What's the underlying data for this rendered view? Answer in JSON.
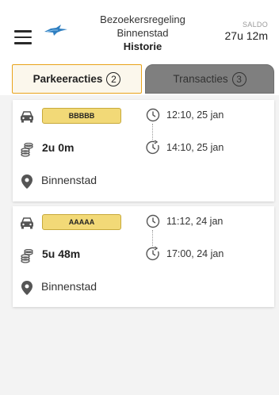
{
  "header": {
    "title_line1": "Bezoekersregeling",
    "title_line2": "Binnenstad",
    "subtitle": "Historie",
    "saldo_label": "SALDO",
    "saldo_value": "27u 12m"
  },
  "tabs": [
    {
      "label": "Parkeeracties",
      "count": "2",
      "active": true
    },
    {
      "label": "Transacties",
      "count": "3",
      "active": false
    }
  ],
  "parkings": [
    {
      "plate": "BBBBB",
      "duration": "2u 0m",
      "location": "Binnenstad",
      "start": "12:10, 25 jan",
      "end": "14:10, 25 jan"
    },
    {
      "plate": "AAAAA",
      "duration": "5u 48m",
      "location": "Binnenstad",
      "start": "11:12, 24 jan",
      "end": "17:00, 24 jan"
    }
  ],
  "icons": {
    "menu": "hamburger-menu-icon",
    "logo": "bird-logo-icon",
    "car": "car-icon",
    "coins": "coins-icon",
    "pin": "location-pin-icon",
    "clock": "clock-icon",
    "clock_end": "clock-forward-icon"
  },
  "colors": {
    "accent": "#e9a31a",
    "plate": "#f2d977",
    "logo": "#2f7fc1",
    "inactive_tab": "#7f7f7f"
  }
}
